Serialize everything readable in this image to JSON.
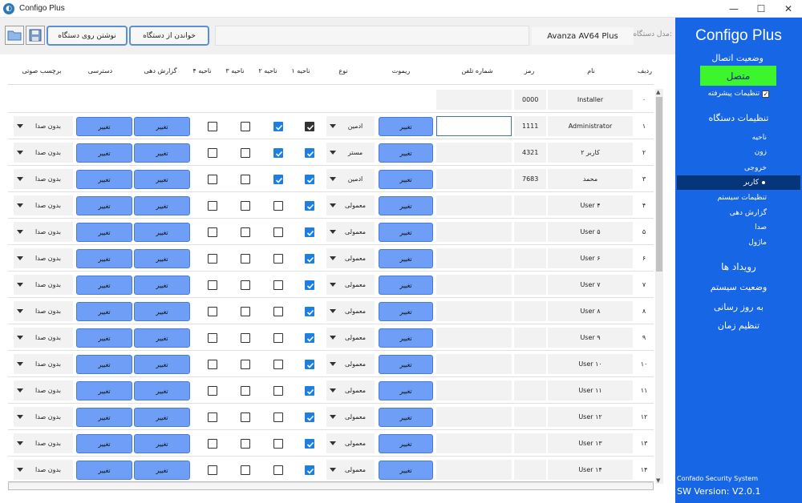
{
  "window": {
    "title": "Configo Plus",
    "minimize": "—",
    "maximize": "☐",
    "close": "✕"
  },
  "toolbar": {
    "read_label": "خواندن از دستگاه",
    "write_label": "نوشتن روی دستگاه",
    "model_label": "مدل دستگاه:",
    "model_value": "Avanza AV64 Plus"
  },
  "sidebar": {
    "brand": "Configo Plus",
    "connection_title": "وضعیت اتصال",
    "connection_status": "متصل",
    "advanced_label": "تنظیمات پیشرفته",
    "advanced_checked": true,
    "device_settings": "تنظیمات دستگاه",
    "items": [
      {
        "label": "ناحیه",
        "active": false
      },
      {
        "label": "زون",
        "active": false
      },
      {
        "label": "خروجی",
        "active": false
      },
      {
        "label": "کاربر",
        "active": true
      },
      {
        "label": "تنظیمات سیستم",
        "active": false
      },
      {
        "label": "گزارش دهی",
        "active": false
      },
      {
        "label": "صدا",
        "active": false
      },
      {
        "label": "ماژول",
        "active": false
      }
    ],
    "sections": [
      "رویداد ها",
      "وضعیت سیستم",
      "به روز رسانی",
      "تنظیم زمان"
    ],
    "footer_company": "Confado Security System",
    "footer_version": "SW Version: V2.0.1"
  },
  "table": {
    "headers": {
      "row": "ردیف",
      "name": "نام",
      "password": "رمز",
      "phone": "شماره تلفن",
      "remote": "ریموت",
      "type": "نوع",
      "area1": "ناحیه ۱",
      "area2": "ناحیه ۲",
      "area3": "ناحیه ۳",
      "area4": "ناحیه ۴",
      "report": "گزارش دهی",
      "access": "دسترسی",
      "voice": "برچسب صوتی"
    },
    "change_label": "تغییر",
    "voice_default": "بدون صدا",
    "rows": [
      {
        "num": "۰",
        "name": "Installer",
        "password": "0000",
        "phone": "",
        "type": "",
        "areas": []
      },
      {
        "num": "۱",
        "name": "Administrator",
        "password": "1111",
        "phone": "",
        "phone_focused": true,
        "type": "ادمین",
        "areas": [
          "dark",
          "blue",
          "off",
          "off"
        ]
      },
      {
        "num": "۲",
        "name": "کاربر ۲",
        "password": "4321",
        "phone": "",
        "type": "مستر",
        "areas": [
          "blue",
          "blue",
          "off",
          "off"
        ]
      },
      {
        "num": "۳",
        "name": "محمد",
        "password": "7683",
        "phone": "",
        "type": "ادمین",
        "areas": [
          "blue",
          "blue",
          "off",
          "off"
        ]
      },
      {
        "num": "۴",
        "name": "User ۴",
        "password": "",
        "phone": "",
        "type": "معمولی",
        "areas": [
          "blue",
          "off",
          "off",
          "off"
        ]
      },
      {
        "num": "۵",
        "name": "User ۵",
        "password": "",
        "phone": "",
        "type": "معمولی",
        "areas": [
          "blue",
          "off",
          "off",
          "off"
        ]
      },
      {
        "num": "۶",
        "name": "User ۶",
        "password": "",
        "phone": "",
        "type": "معمولی",
        "areas": [
          "blue",
          "off",
          "off",
          "off"
        ]
      },
      {
        "num": "۷",
        "name": "User ۷",
        "password": "",
        "phone": "",
        "type": "معمولی",
        "areas": [
          "blue",
          "off",
          "off",
          "off"
        ]
      },
      {
        "num": "۸",
        "name": "User ۸",
        "password": "",
        "phone": "",
        "type": "معمولی",
        "areas": [
          "blue",
          "off",
          "off",
          "off"
        ]
      },
      {
        "num": "۹",
        "name": "User ۹",
        "password": "",
        "phone": "",
        "type": "معمولی",
        "areas": [
          "blue",
          "off",
          "off",
          "off"
        ]
      },
      {
        "num": "۱۰",
        "name": "User ۱۰",
        "password": "",
        "phone": "",
        "type": "معمولی",
        "areas": [
          "blue",
          "off",
          "off",
          "off"
        ]
      },
      {
        "num": "۱۱",
        "name": "User ۱۱",
        "password": "",
        "phone": "",
        "type": "معمولی",
        "areas": [
          "blue",
          "off",
          "off",
          "off"
        ]
      },
      {
        "num": "۱۲",
        "name": "User ۱۲",
        "password": "",
        "phone": "",
        "type": "معمولی",
        "areas": [
          "blue",
          "off",
          "off",
          "off"
        ]
      },
      {
        "num": "۱۳",
        "name": "User ۱۳",
        "password": "",
        "phone": "",
        "type": "معمولی",
        "areas": [
          "blue",
          "off",
          "off",
          "off"
        ]
      },
      {
        "num": "۱۴",
        "name": "User ۱۴",
        "password": "",
        "phone": "",
        "type": "معمولی",
        "areas": [
          "blue",
          "off",
          "off",
          "off"
        ]
      }
    ]
  },
  "colors": {
    "sidebar": "#1766e6",
    "connected": "#3cf52c",
    "button": "#6e9ef5",
    "checked": "#1e7fe0"
  }
}
